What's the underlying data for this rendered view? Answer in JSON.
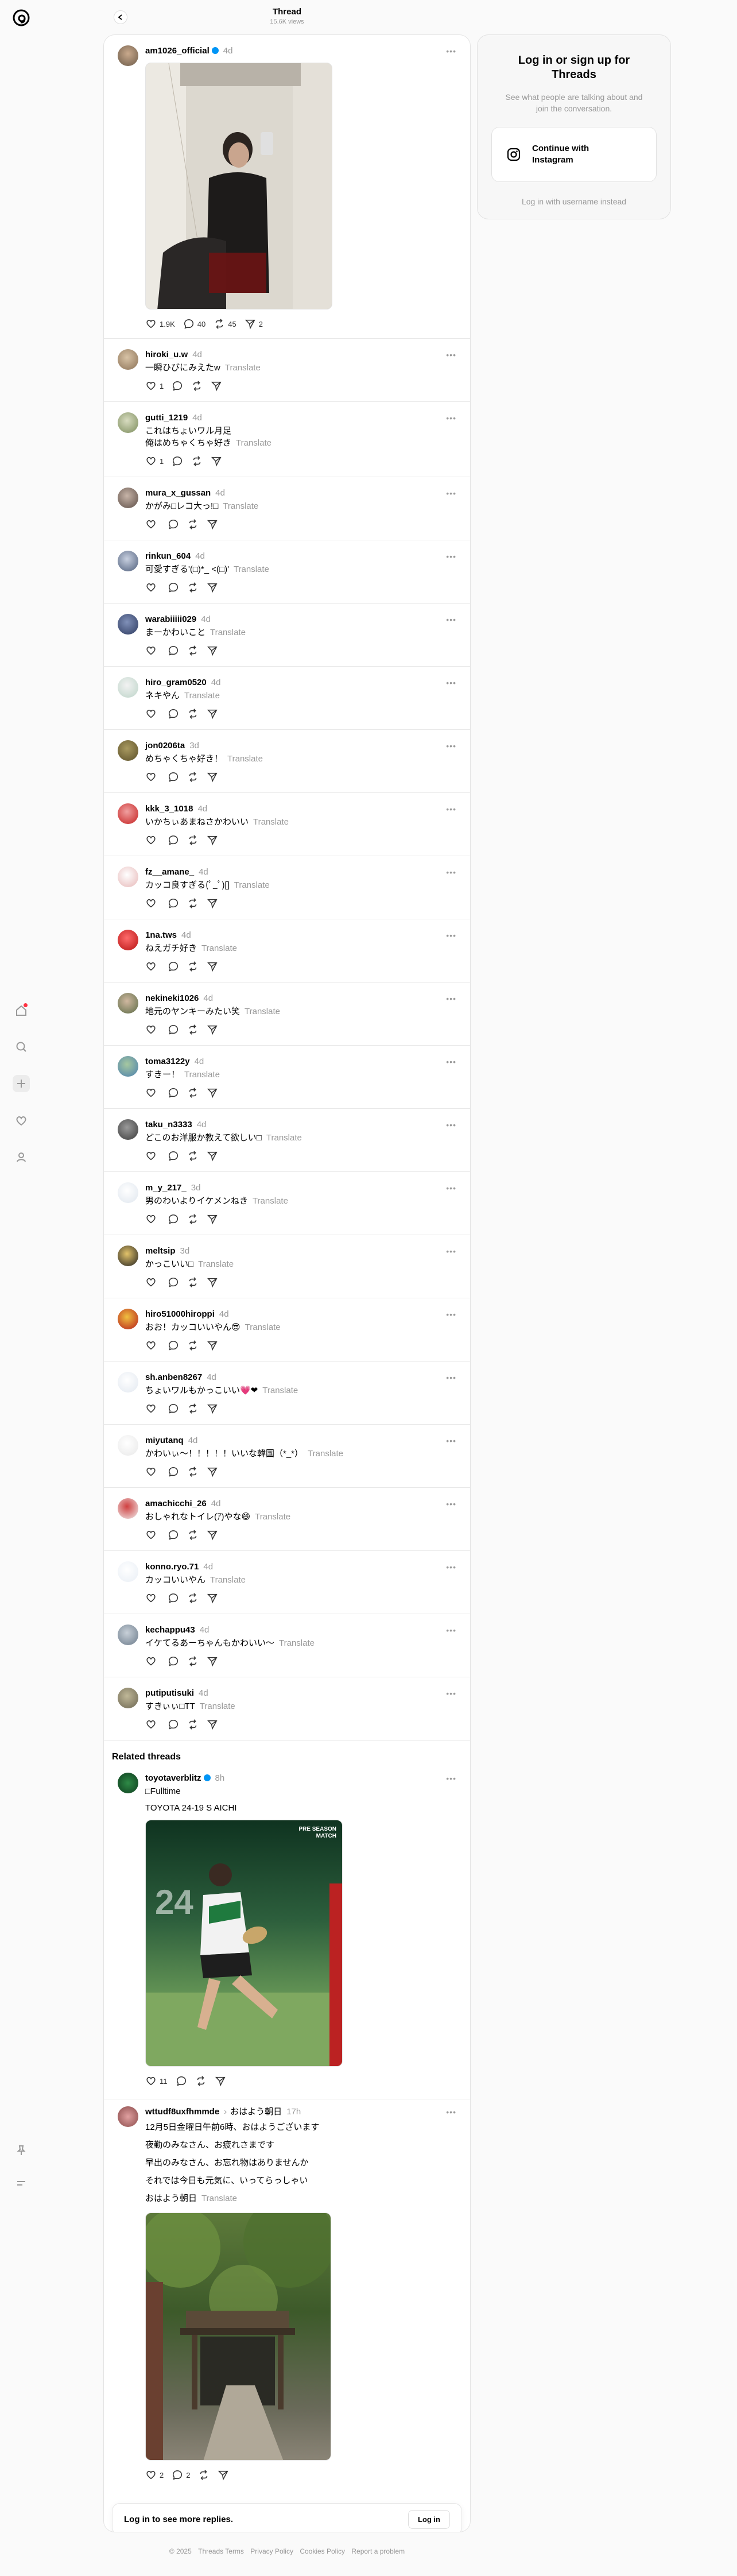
{
  "header": {
    "title": "Thread",
    "views": "15.6K views"
  },
  "main_post": {
    "user": "am1026_official",
    "verified": true,
    "time": "4d",
    "likes": "1.9K",
    "replies": "40",
    "reposts": "45",
    "shares": "2"
  },
  "replies": [
    {
      "user": "hiroki_u.w",
      "time": "4d",
      "text": "一瞬ひびにみえたw",
      "likes": "1",
      "c1": "#8a7055",
      "c2": "#d8c3a6"
    },
    {
      "user": "gutti_1219",
      "time": "4d",
      "text": "これはちょいワル月足\n俺はめちゃくちゃ好き",
      "likes": "1",
      "c1": "#7a8b5b",
      "c2": "#d8dcc0"
    },
    {
      "user": "mura_x_gussan",
      "time": "4d",
      "text": "かがみ□レコ大っ!□",
      "likes": "",
      "c1": "#5b4c45",
      "c2": "#c7b4a8"
    },
    {
      "user": "rinkun_604",
      "time": "4d",
      "text": "可愛すぎる'(□)*_ <(□)'",
      "likes": "",
      "c1": "#4d5d7a",
      "c2": "#c8d0e0"
    },
    {
      "user": "warabiiiii029",
      "time": "4d",
      "text": "まーかわいこと",
      "likes": "",
      "c1": "#2d3a5f",
      "c2": "#8090b8"
    },
    {
      "user": "hiro_gram0520",
      "time": "4d",
      "text": "ネキやん",
      "likes": "",
      "c1": "#bcd4c8",
      "c2": "#f2f2f2"
    },
    {
      "user": "jon0206ta",
      "time": "3d",
      "text": "めちゃくちゃ好き！",
      "likes": "",
      "c1": "#5a4e28",
      "c2": "#a99a60"
    },
    {
      "user": "kkk_3_1018",
      "time": "4d",
      "text": "いかちぃあまねさかわいい",
      "likes": "",
      "c1": "#c41e1e",
      "c2": "#f0a0a0"
    },
    {
      "user": "fz__amane_",
      "time": "4d",
      "text": "カッコ良すぎる(ﾟ_ﾟ)[]",
      "likes": "",
      "c1": "#e6b6b6",
      "c2": "#ffffff"
    },
    {
      "user": "1na.tws",
      "time": "4d",
      "text": "ねえガチ好き",
      "likes": "",
      "c1": "#b51212",
      "c2": "#ff6b6b"
    },
    {
      "user": "nekineki1026",
      "time": "4d",
      "text": "地元のヤンキーみたい笑",
      "likes": "",
      "c1": "#5a6a45",
      "c2": "#d0b8a0"
    },
    {
      "user": "toma3122y",
      "time": "4d",
      "text": "すきー！",
      "likes": "",
      "c1": "#4a7fae",
      "c2": "#a6c8a0"
    },
    {
      "user": "taku_n3333",
      "time": "4d",
      "text": "どこのお洋服か教えて欲しい□",
      "likes": "",
      "c1": "#3a3a3a",
      "c2": "#9a9a9a"
    },
    {
      "user": "m_y_217_",
      "time": "3d",
      "text": "男のわいよりイケメンねき",
      "likes": "",
      "c1": "#dfe6ee",
      "c2": "#ffffff"
    },
    {
      "user": "meltsip",
      "time": "3d",
      "text": "かっこいい□",
      "likes": "",
      "c1": "#1f1f1f",
      "c2": "#e3c36a"
    },
    {
      "user": "hiro51000hiroppi",
      "time": "4d",
      "text": "おお！カッコいいやん😎",
      "likes": "",
      "c1": "#b51a1a",
      "c2": "#f0c040"
    },
    {
      "user": "sh.anben8267",
      "time": "4d",
      "text": "ちょいワルもかっこいい💗❤",
      "likes": "",
      "c1": "#e2e8f0",
      "c2": "#ffffff"
    },
    {
      "user": "miyutanq",
      "time": "4d",
      "text": "かわいぃ〜！！！！！いいな韓国（*_*）",
      "likes": "",
      "c1": "#e8e8e8",
      "c2": "#ffffff"
    },
    {
      "user": "amachicchi_26",
      "time": "4d",
      "text": "おしゃれなトイレ(ｱ)やな😄",
      "likes": "",
      "c1": "#f0f0f0",
      "c2": "#d04040"
    },
    {
      "user": "konno.ryo.71",
      "time": "4d",
      "text": "カッコいいやん",
      "likes": "",
      "c1": "#e8eef5",
      "c2": "#ffffff"
    },
    {
      "user": "kechappu43",
      "time": "4d",
      "text": "イケてるあーちゃんもかわいい〜",
      "likes": "",
      "c1": "#6a7a8a",
      "c2": "#c8d0d8"
    },
    {
      "user": "putiputisuki",
      "time": "4d",
      "text": "すきぃぃ□TT",
      "likes": "",
      "c1": "#6a6450",
      "c2": "#c0b898"
    }
  ],
  "translate_label": "Translate",
  "related": {
    "heading": "Related threads",
    "posts": [
      {
        "user": "toyotaverblitz",
        "verified": true,
        "time": "8h",
        "text_lines": [
          "□Fulltime",
          "TOYOTA 24-19 S AICHI"
        ],
        "likes": "11",
        "replies": "",
        "reposts": "",
        "shares": "",
        "image_badge": "PRE SEASON MATCH",
        "image_score": "24"
      },
      {
        "user": "wttudf8uxfhmmde",
        "sub": "おはよう朝日",
        "time": "17h",
        "text_lines": [
          "12月5日金曜日午前6時、おはようございます",
          "夜勤のみなさん、お疲れさまです",
          "早出のみなさん、お忘れ物はありませんか",
          "それでは今日も元気に、いってらっしゃい",
          "おはよう朝日"
        ],
        "likes": "2",
        "replies": "2",
        "reposts": "",
        "shares": ""
      }
    ]
  },
  "login_bar": {
    "text": "Log in to see more replies.",
    "button": "Log in"
  },
  "card": {
    "title": "Log in or sign up for Threads",
    "subtitle": "See what people are talking about and join the conversation.",
    "button": "Continue with Instagram",
    "alt": "Log in with username instead"
  },
  "footer": [
    "© 2025",
    "Threads Terms",
    "Privacy Policy",
    "Cookies Policy",
    "Report a problem"
  ]
}
